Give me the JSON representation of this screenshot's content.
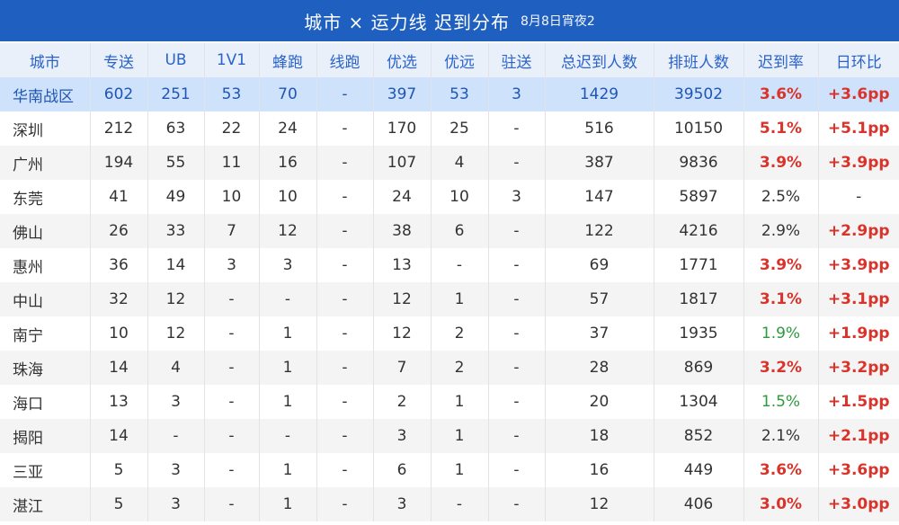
{
  "header": {
    "title": "城市 × 运力线 迟到分布",
    "subtitle": "8月8日宵夜2"
  },
  "columns": [
    "城市",
    "专送",
    "UB",
    "1V1",
    "蜂跑",
    "线跑",
    "优选",
    "优远",
    "驻送",
    "总迟到人数",
    "排班人数",
    "迟到率",
    "日环比"
  ],
  "rate_colors": {
    "high": "#d9342b",
    "low": "#2d9a3e",
    "neutral": "#333333"
  },
  "rows": [
    {
      "cells": [
        "华南战区",
        "602",
        "251",
        "53",
        "70",
        "-",
        "397",
        "53",
        "3",
        "1429",
        "39502",
        "3.6%",
        "+3.6pp"
      ],
      "rate_status": "high",
      "delta_status": "high",
      "summary": true
    },
    {
      "cells": [
        "深圳",
        "212",
        "63",
        "22",
        "24",
        "-",
        "170",
        "25",
        "-",
        "516",
        "10150",
        "5.1%",
        "+5.1pp"
      ],
      "rate_status": "high",
      "delta_status": "high"
    },
    {
      "cells": [
        "广州",
        "194",
        "55",
        "11",
        "16",
        "-",
        "107",
        "4",
        "-",
        "387",
        "9836",
        "3.9%",
        "+3.9pp"
      ],
      "rate_status": "high",
      "delta_status": "high"
    },
    {
      "cells": [
        "东莞",
        "41",
        "49",
        "10",
        "10",
        "-",
        "24",
        "10",
        "3",
        "147",
        "5897",
        "2.5%",
        "-"
      ],
      "rate_status": "neutral",
      "delta_status": "neutral"
    },
    {
      "cells": [
        "佛山",
        "26",
        "33",
        "7",
        "12",
        "-",
        "38",
        "6",
        "-",
        "122",
        "4216",
        "2.9%",
        "+2.9pp"
      ],
      "rate_status": "neutral",
      "delta_status": "high"
    },
    {
      "cells": [
        "惠州",
        "36",
        "14",
        "3",
        "3",
        "-",
        "13",
        "-",
        "-",
        "69",
        "1771",
        "3.9%",
        "+3.9pp"
      ],
      "rate_status": "high",
      "delta_status": "high"
    },
    {
      "cells": [
        "中山",
        "32",
        "12",
        "-",
        "-",
        "-",
        "12",
        "1",
        "-",
        "57",
        "1817",
        "3.1%",
        "+3.1pp"
      ],
      "rate_status": "high",
      "delta_status": "high"
    },
    {
      "cells": [
        "南宁",
        "10",
        "12",
        "-",
        "1",
        "-",
        "12",
        "2",
        "-",
        "37",
        "1935",
        "1.9%",
        "+1.9pp"
      ],
      "rate_status": "low",
      "delta_status": "high"
    },
    {
      "cells": [
        "珠海",
        "14",
        "4",
        "-",
        "1",
        "-",
        "7",
        "2",
        "-",
        "28",
        "869",
        "3.2%",
        "+3.2pp"
      ],
      "rate_status": "high",
      "delta_status": "high"
    },
    {
      "cells": [
        "海口",
        "13",
        "3",
        "-",
        "1",
        "-",
        "2",
        "1",
        "-",
        "20",
        "1304",
        "1.5%",
        "+1.5pp"
      ],
      "rate_status": "low",
      "delta_status": "high"
    },
    {
      "cells": [
        "揭阳",
        "14",
        "-",
        "-",
        "-",
        "-",
        "3",
        "1",
        "-",
        "18",
        "852",
        "2.1%",
        "+2.1pp"
      ],
      "rate_status": "neutral",
      "delta_status": "high"
    },
    {
      "cells": [
        "三亚",
        "5",
        "3",
        "-",
        "1",
        "-",
        "6",
        "1",
        "-",
        "16",
        "449",
        "3.6%",
        "+3.6pp"
      ],
      "rate_status": "high",
      "delta_status": "high"
    },
    {
      "cells": [
        "湛江",
        "5",
        "3",
        "-",
        "1",
        "-",
        "3",
        "-",
        "-",
        "12",
        "406",
        "3.0%",
        "+3.0pp"
      ],
      "rate_status": "high",
      "delta_status": "high"
    }
  ]
}
